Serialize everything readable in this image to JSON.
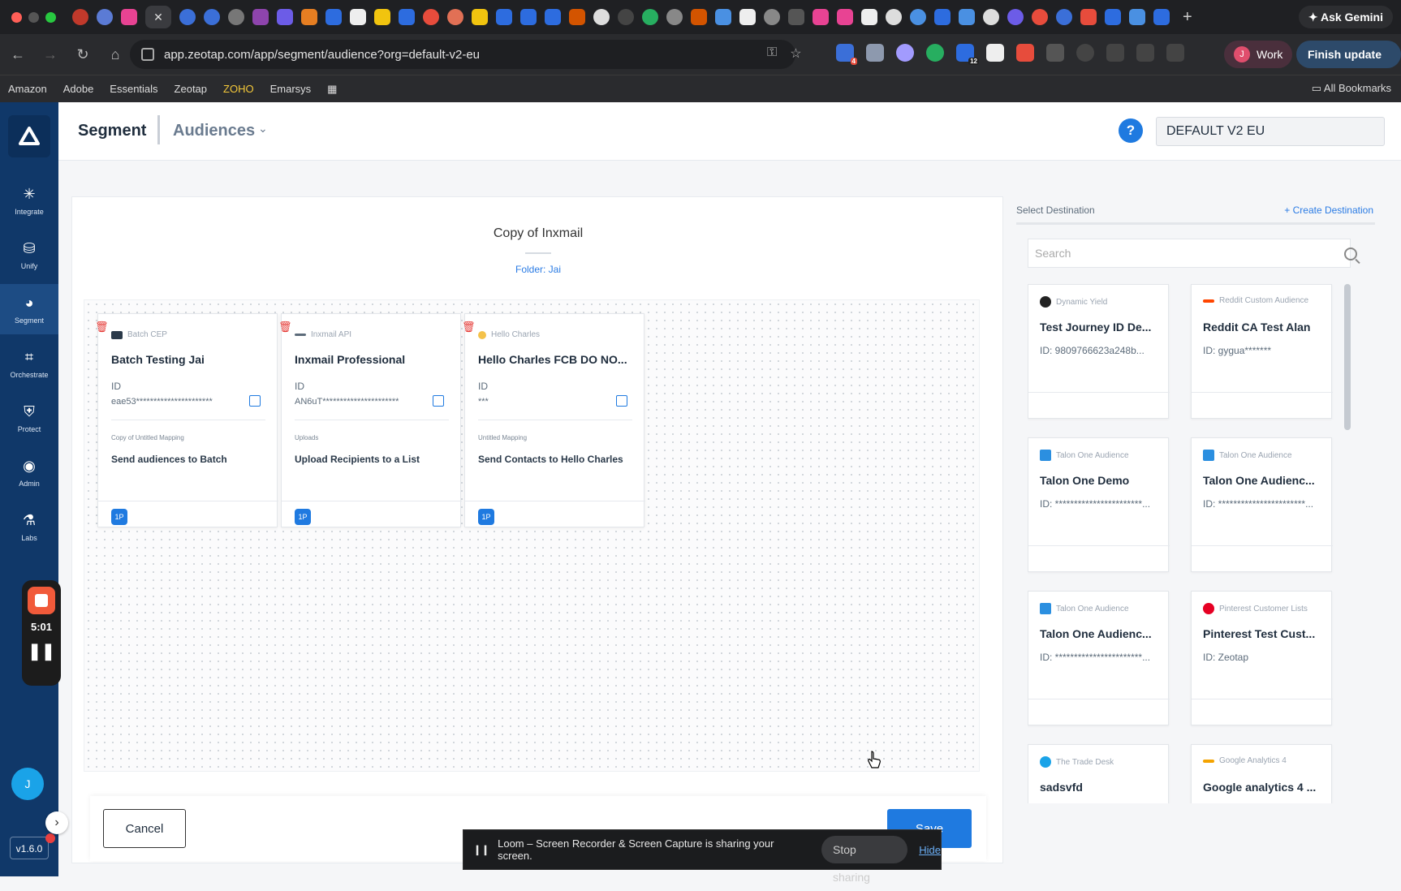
{
  "browser": {
    "ask_gemini": "Ask Gemini",
    "url": "app.zeotap.com/app/segment/audience?org=default-v2-eu",
    "work_label": "Work",
    "work_avatar": "J",
    "finish_update": "Finish update",
    "ext_badge_1": "4",
    "ext_badge_2": "12",
    "bookmarks": [
      "Amazon",
      "Adobe",
      "Essentials",
      "Zeotap",
      "ZOHO",
      "Emarsys"
    ],
    "all_bookmarks": "All Bookmarks"
  },
  "sidebar": {
    "items": [
      {
        "label": "Integrate",
        "icon": "integrate-icon"
      },
      {
        "label": "Unify",
        "icon": "database-icon"
      },
      {
        "label": "Segment",
        "icon": "pie-chart-icon"
      },
      {
        "label": "Orchestrate",
        "icon": "workflow-icon"
      },
      {
        "label": "Protect",
        "icon": "shield-icon"
      },
      {
        "label": "Admin",
        "icon": "user-circle-icon"
      },
      {
        "label": "Labs",
        "icon": "flask-icon"
      }
    ],
    "avatar": "J",
    "version": "v1.6.0"
  },
  "loom": {
    "timer": "5:01",
    "sharing_text": "Loom – Screen Recorder & Screen Capture is sharing your screen.",
    "stop_sharing": "Stop sharing",
    "hide": "Hide"
  },
  "header": {
    "segment": "Segment",
    "audiences": "Audiences",
    "org": "DEFAULT V2 EU",
    "help": "?"
  },
  "audience": {
    "title": "Copy of Inxmail",
    "folder": "Folder: Jai"
  },
  "destinations": [
    {
      "type": "Batch CEP",
      "name": "Batch Testing Jai",
      "id_label": "ID",
      "id": "eae53**********************",
      "mapping_label": "Copy of Untitled Mapping",
      "mapping": "Send audiences to Batch",
      "badge": "1P",
      "color": "#2b3a4a"
    },
    {
      "type": "Inxmail API",
      "name": "Inxmail Professional",
      "id_label": "ID",
      "id": "AN6uT**********************",
      "mapping_label": "Uploads",
      "mapping": "Upload Recipients to a List",
      "badge": "1P",
      "color": "#5c6b7a"
    },
    {
      "type": "Hello Charles",
      "name": "Hello Charles FCB DO NO...",
      "id_label": "ID",
      "id": "***",
      "mapping_label": "Untitled Mapping",
      "mapping": "Send Contacts to Hello Charles",
      "badge": "1P",
      "color": "#f4c24a"
    }
  ],
  "actions": {
    "cancel": "Cancel",
    "save": "Save"
  },
  "select_destination": {
    "title": "Select Destination",
    "create": "+ Create Destination",
    "search_placeholder": "Search",
    "cards": [
      {
        "type": "Dynamic Yield",
        "name": "Test Journey ID De...",
        "id": "ID: 9809766623a248b...",
        "color": "#222"
      },
      {
        "type": "Reddit Custom Audience",
        "name": "Reddit CA Test Alan",
        "id": "ID: gygua*******",
        "color": "#ff4500"
      },
      {
        "type": "Talon One Audience",
        "name": "Talon One Demo",
        "id": "ID: ***********************...",
        "color": "#2b8fe0"
      },
      {
        "type": "Talon One Audience",
        "name": "Talon One Audienc...",
        "id": "ID: ***********************...",
        "color": "#2b8fe0"
      },
      {
        "type": "Talon One Audience",
        "name": "Talon One Audienc...",
        "id": "ID: ***********************...",
        "color": "#2b8fe0"
      },
      {
        "type": "Pinterest Customer Lists",
        "name": "Pinterest Test Cust...",
        "id": "ID: Zeotap",
        "color": "#e60023"
      },
      {
        "type": "The Trade Desk",
        "name": "sadsvfd",
        "id": "",
        "color": "#1aa3e8"
      },
      {
        "type": "Google Analytics 4",
        "name": "Google analytics 4 ...",
        "id": "",
        "color": "#f4a300"
      }
    ]
  }
}
